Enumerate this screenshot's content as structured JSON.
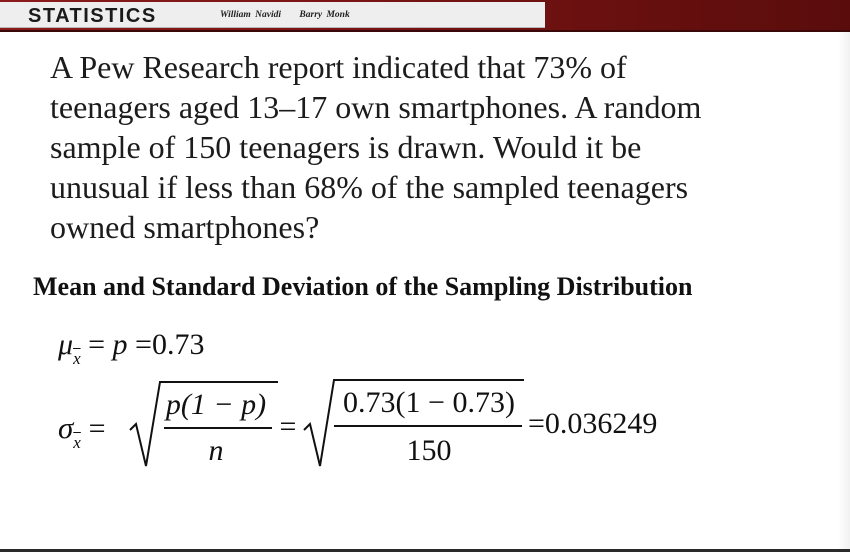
{
  "header": {
    "title": "STATISTICS",
    "authors": [
      "William Navidi",
      "Barry Monk"
    ]
  },
  "problem_lines": [
    "A Pew Research report indicated that 73% of",
    "teenagers aged 13–17 own smartphones. A random",
    "sample of 150 teenagers is drawn. Would it be",
    "unusual if less than 68% of the sampled teenagers",
    "owned smartphones?"
  ],
  "section_heading": "Mean and Standard Deviation of the Sampling Distribution",
  "mean_formula": {
    "symbol": "μ",
    "subscript": "x",
    "equals1": "=",
    "p": "p",
    "equals2": "=",
    "value": "0.73"
  },
  "sd_formula": {
    "symbol": "σ",
    "subscript": "x",
    "equals": "=",
    "general_numerator": "p(1 − p)",
    "general_denominator": "n",
    "equals2": "=",
    "numeric_numerator": "0.73(1 − 0.73)",
    "numeric_denominator": "150",
    "equals3": "=",
    "result": "0.036249"
  }
}
